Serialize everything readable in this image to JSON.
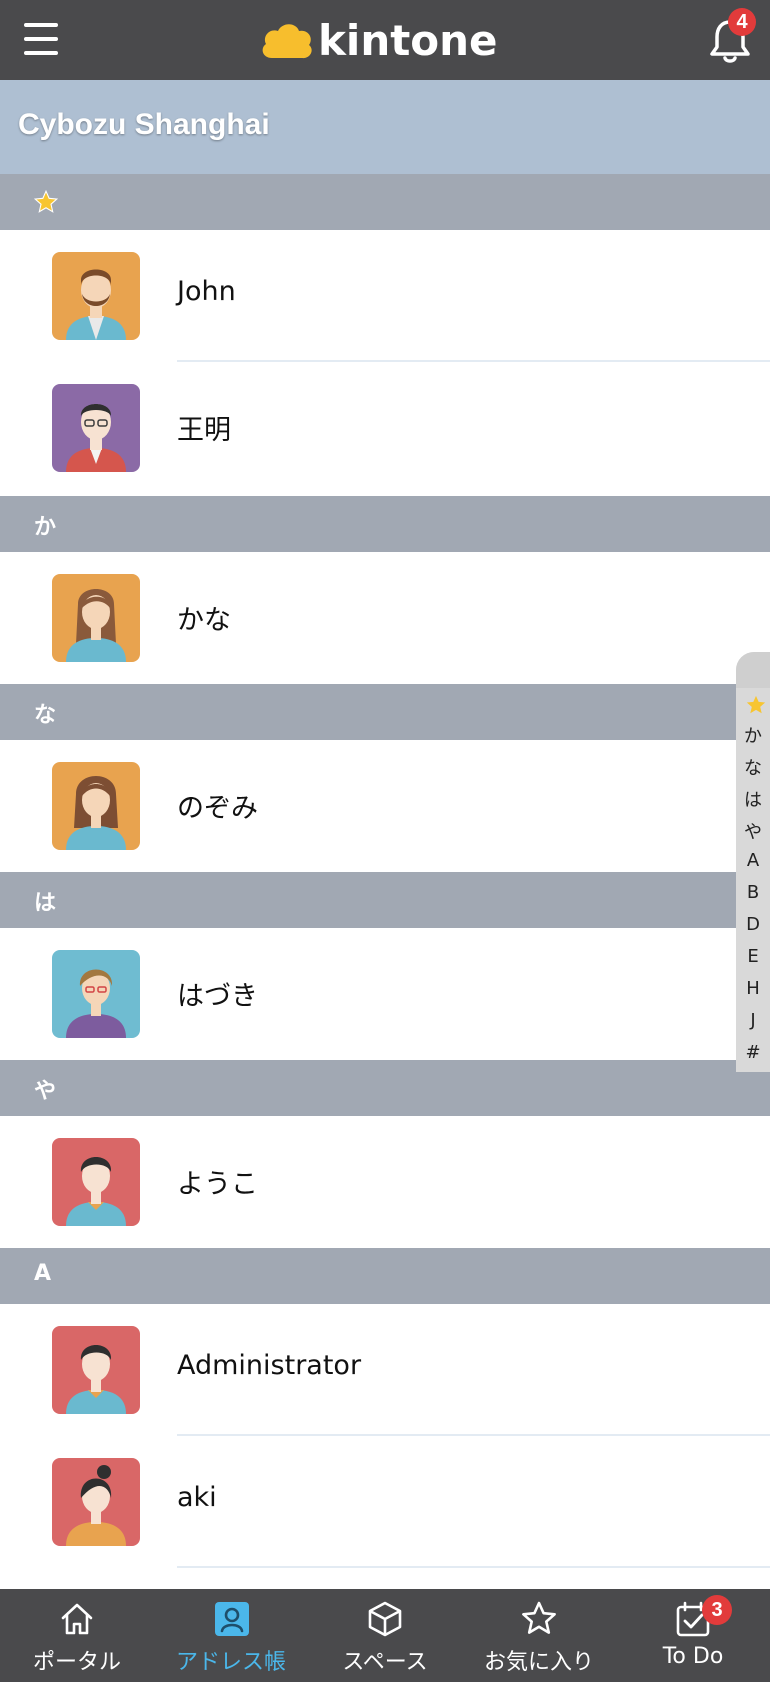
{
  "app": {
    "brand": "kintone",
    "notification_count": "4"
  },
  "space": {
    "title": "Cybozu Shanghai"
  },
  "sections": [
    {
      "label": "",
      "icon": "star-icon",
      "contacts": [
        {
          "name": "John",
          "avatar_color": "#e8a34f",
          "avatar": "man-beard-avatar"
        },
        {
          "name": "王明",
          "avatar_color": "#8b6aa6",
          "avatar": "man-glasses-avatar"
        }
      ]
    },
    {
      "label": "か",
      "contacts": [
        {
          "name": "かな",
          "avatar_color": "#e8a34f",
          "avatar": "woman-avatar"
        }
      ]
    },
    {
      "label": "な",
      "contacts": [
        {
          "name": "のぞみ",
          "avatar_color": "#e8a34f",
          "avatar": "woman-avatar"
        }
      ]
    },
    {
      "label": "は",
      "contacts": [
        {
          "name": "はづき",
          "avatar_color": "#6fbcd1",
          "avatar": "woman-glasses-avatar"
        }
      ]
    },
    {
      "label": "や",
      "contacts": [
        {
          "name": "ようこ",
          "avatar_color": "#d96767",
          "avatar": "man-avatar"
        }
      ]
    },
    {
      "label": "A",
      "contacts": [
        {
          "name": "Administrator",
          "avatar_color": "#d96767",
          "avatar": "man-avatar"
        },
        {
          "name": "aki",
          "avatar_color": "#d96767",
          "avatar": "woman-bun-avatar"
        }
      ]
    }
  ],
  "index_bar": [
    "か",
    "な",
    "は",
    "や",
    "A",
    "B",
    "D",
    "E",
    "H",
    "J",
    "#"
  ],
  "tabs": [
    {
      "label": "ポータル",
      "icon": "home-icon",
      "active": false
    },
    {
      "label": "アドレス帳",
      "icon": "address-book-icon",
      "active": true
    },
    {
      "label": "スペース",
      "icon": "cube-icon",
      "active": false
    },
    {
      "label": "お気に入り",
      "icon": "star-outline-icon",
      "active": false
    },
    {
      "label": "To Do",
      "icon": "todo-check-icon",
      "active": false
    }
  ],
  "todo_badge": "3",
  "colors": {
    "topbar": "#4a4a4c",
    "space_header": "#aebfd2",
    "section": "#a1a8b3",
    "active_tab": "#4bb7ea",
    "badge": "#e23b3b"
  }
}
